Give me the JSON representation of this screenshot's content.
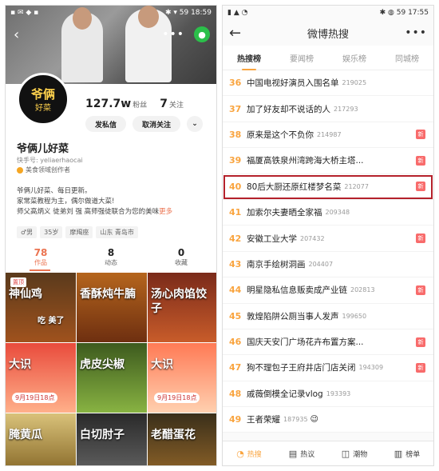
{
  "left": {
    "status": {
      "icons": "▪ ✉ ◆ ▪",
      "right": "✱ ▾ 59",
      "time": "18:59"
    },
    "wechat_glyph": "●",
    "avatar_text1": "爷俩",
    "avatar_text2": "好菜",
    "stats": {
      "fans_num": "127.7w",
      "fans_label": "粉丝",
      "follow_num": "7",
      "follow_label": "关注"
    },
    "buttons": {
      "message": "发私信",
      "unfollow": "取消关注",
      "dropdown": "⌄"
    },
    "name": "爷俩儿好菜",
    "uid": "快手号: yeliaerhaocai",
    "verify": "美食领域创作者",
    "bio": {
      "line1": "爷俩儿好菜、每日更新。",
      "line2": "家常菜教程为主，偶尔做道大菜!",
      "line3": "师父高炳义 徒弟刘 强 高师强徒联合为您的美味",
      "more": "更多"
    },
    "tags": [
      "♂男",
      "35岁",
      "摩羯座",
      "山东 青岛市"
    ],
    "tabs": [
      {
        "num": "78",
        "label": "作品"
      },
      {
        "num": "8",
        "label": "动态"
      },
      {
        "num": "0",
        "label": "收藏"
      }
    ],
    "grid": [
      {
        "caption": "神仙鸡",
        "sub": "吃 美了",
        "badge": "置顶"
      },
      {
        "caption": "香酥炖牛腩",
        "sub": ""
      },
      {
        "caption": "汤心肉馅饺子",
        "sub": ""
      },
      {
        "caption": "大识",
        "sub": "",
        "date": "9月19日18点"
      },
      {
        "caption": "虎皮尖椒",
        "sub": ""
      },
      {
        "caption": "大识",
        "sub": "",
        "date": "9月19日18点"
      },
      {
        "caption": "腌黄瓜",
        "sub": ""
      },
      {
        "caption": "白切肘子",
        "sub": ""
      },
      {
        "caption": "老醋蛋花",
        "sub": ""
      }
    ]
  },
  "right": {
    "status": {
      "icons": "▮ ▲ ◔",
      "right": "✱ ◍ 59",
      "time": "17:55"
    },
    "back": "←",
    "title": "微博热搜",
    "more": "•••",
    "tabs": [
      "热搜榜",
      "要闻榜",
      "娱乐榜",
      "同城榜"
    ],
    "rows": [
      {
        "rank": "36",
        "text": "中国电视好演员入围名单",
        "count": "219025",
        "new": false
      },
      {
        "rank": "37",
        "text": "加了好友却不说话的人",
        "count": "217293",
        "new": false
      },
      {
        "rank": "38",
        "text": "原来是这个不负你",
        "count": "214987",
        "new": true
      },
      {
        "rank": "39",
        "text": "福厦高铁泉州湾跨海大桥主塔...",
        "count": "",
        "new": true
      },
      {
        "rank": "40",
        "text": "80后大厨还原红楼梦名菜",
        "count": "212077",
        "new": true
      },
      {
        "rank": "41",
        "text": "加索尔夫妻晒全家福",
        "count": "209348",
        "new": false
      },
      {
        "rank": "42",
        "text": "安徽工业大学",
        "count": "207432",
        "new": true
      },
      {
        "rank": "43",
        "text": "南京手绘树洞画",
        "count": "204407",
        "new": false
      },
      {
        "rank": "44",
        "text": "明星隐私信息贩卖成产业链",
        "count": "202813",
        "new": true
      },
      {
        "rank": "45",
        "text": "敦煌陷阱公厕当事人发声",
        "count": "199650",
        "new": false
      },
      {
        "rank": "46",
        "text": "国庆天安门广场花卉布置方案...",
        "count": "",
        "new": true
      },
      {
        "rank": "47",
        "text": "狗不理包子王府井店门店关闭",
        "count": "194309",
        "new": true
      },
      {
        "rank": "48",
        "text": "戚薇倒模全记录vlog",
        "count": "193393",
        "new": false
      },
      {
        "rank": "49",
        "text": "王者荣耀",
        "count": "187935",
        "new": false,
        "emoji": "😉"
      }
    ],
    "new_label": "新",
    "bottom": [
      {
        "icon": "◔",
        "label": "热搜"
      },
      {
        "icon": "▤",
        "label": "热议"
      },
      {
        "icon": "◫",
        "label": "潮物"
      },
      {
        "icon": "▥",
        "label": "榜单"
      }
    ]
  }
}
